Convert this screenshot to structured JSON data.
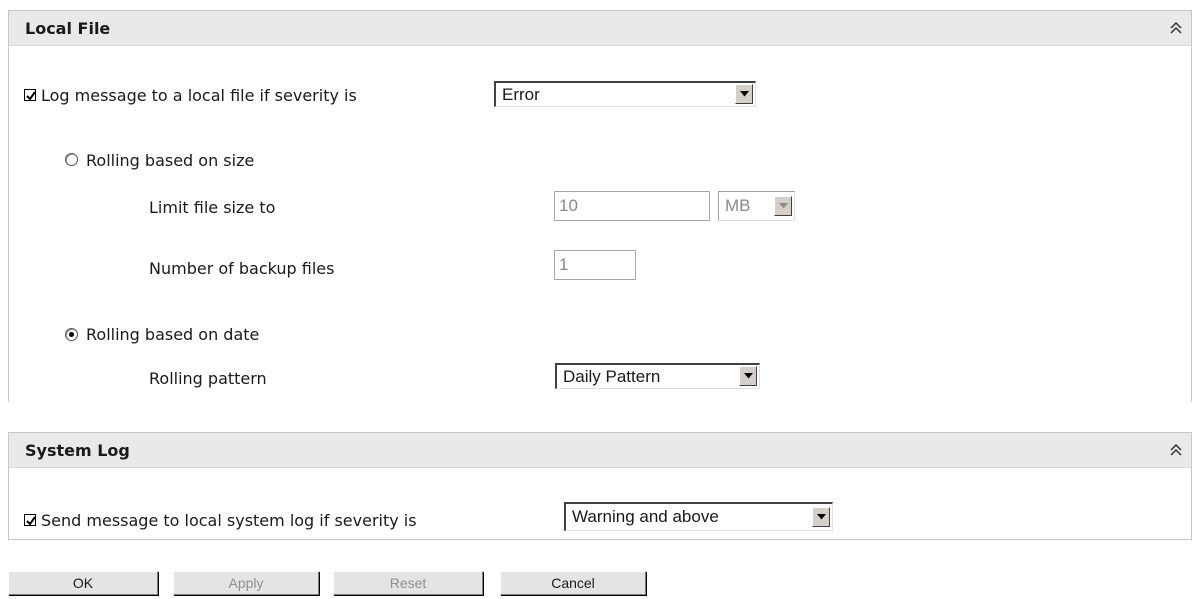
{
  "local_file": {
    "title": "Local File",
    "log_checkbox_checked": true,
    "log_label": "Log message to a local file if severity is",
    "severity_selected": "Error",
    "rolling_size_label": "Rolling based on size",
    "rolling_size_selected": false,
    "limit_label": "Limit file size to",
    "limit_value": "10",
    "limit_unit": "MB",
    "backup_label": "Number of backup files",
    "backup_value": "1",
    "rolling_date_label": "Rolling based on date",
    "rolling_date_selected": true,
    "pattern_label": "Rolling pattern",
    "pattern_selected": "Daily Pattern"
  },
  "system_log": {
    "title": "System Log",
    "send_checkbox_checked": true,
    "send_label": "Send message to local system log if severity is",
    "severity_selected": "Warning and above"
  },
  "buttons": {
    "ok": "OK",
    "apply": "Apply",
    "reset": "Reset",
    "cancel": "Cancel"
  },
  "icons": {
    "collapse": "double-chevron-up-icon",
    "dropdown": "triangle-down-icon"
  }
}
